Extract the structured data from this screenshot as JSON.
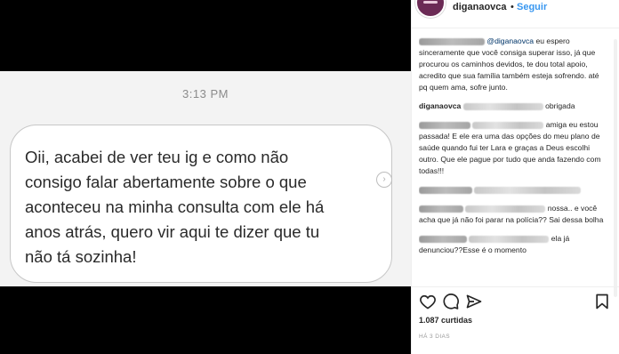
{
  "post": {
    "time": "3:13 PM",
    "message": "Oii, acabei de ver teu ig e como não\nconsigo falar abertamente sobre o que\naconteceu na minha consulta com ele há\nanos atrás, quero vir aqui te dizer que tu\nnão tá sozinha!",
    "share_glyph": "›"
  },
  "header": {
    "username": "diganaovca",
    "separator": "•",
    "follow_label": "Seguir"
  },
  "comments": [
    {
      "mention": "@diganaovca",
      "text_after_mention": " eu espero sinceramente que você consiga superar isso, já que procurou os caminhos devidos, te dou total apoio, acredito que sua família também esteja sofrendo. até pq quem ama, sofre junto."
    },
    {
      "username": "diganaovca",
      "text": "obrigada"
    },
    {
      "text": "amiga eu estou passada! E ele era uma das opções do meu plano de saúde quando fui ter Lara e graças a Deus escolhi outro. Que ele pague por tudo que anda fazendo com todas!!!"
    },
    {
      "text": "nossa.. e você acha que já não foi parar na polícia?? Sai dessa bolha"
    },
    {
      "text": "ela já denunciou??Esse é o momento"
    }
  ],
  "footer": {
    "likes": "1.087 curtidas",
    "time_ago": "HÁ 3 DIAS"
  },
  "colors": {
    "link": "#3897f0",
    "mention": "#003569",
    "avatar": "#6b2a55"
  },
  "icons": [
    "heart-icon",
    "comment-icon",
    "share-icon",
    "bookmark-icon"
  ]
}
